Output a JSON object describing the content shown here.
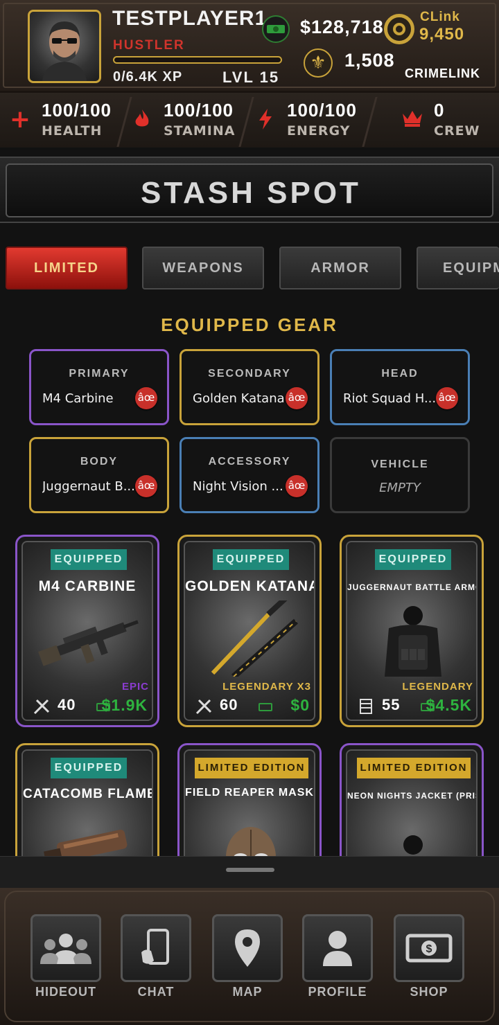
{
  "header": {
    "player_name": "TESTPLAYER1",
    "rank": "HUSTLER",
    "xp_text": "0/6.4K XP",
    "xp_progress": 0.0,
    "level_text": "LVL 15",
    "cash": "$128,718",
    "clink_label": "CLink",
    "clink_value": "9,450",
    "fleur_value": "1,508",
    "crimelink_label": "CRIMELINK"
  },
  "stats": [
    {
      "value": "100/100",
      "label": "HEALTH",
      "icon": "plus-icon",
      "color": "#e0302a"
    },
    {
      "value": "100/100",
      "label": "STAMINA",
      "icon": "flame-icon",
      "color": "#e0302a"
    },
    {
      "value": "100/100",
      "label": "ENERGY",
      "icon": "lightning-icon",
      "color": "#e0302a"
    },
    {
      "value": "0",
      "label": "CREW",
      "icon": "crown-icon",
      "color": "#e0302a"
    }
  ],
  "page_title": "STASH SPOT",
  "tabs": [
    {
      "label": "LIMITED",
      "active": true
    },
    {
      "label": "WEAPONS",
      "active": false
    },
    {
      "label": "ARMOR",
      "active": false
    },
    {
      "label": "EQUIPMENT",
      "active": false
    }
  ],
  "equipped_heading": "EQUIPPED GEAR",
  "slots": [
    {
      "label": "PRIMARY",
      "item": "M4 Carbine",
      "remove": "âœ",
      "rarity": "epic"
    },
    {
      "label": "SECONDARY",
      "item": "Golden Katana",
      "remove": "âœ",
      "rarity": "legendary"
    },
    {
      "label": "HEAD",
      "item": "Riot Squad H...",
      "remove": "âœ",
      "rarity": "rare"
    },
    {
      "label": "BODY",
      "item": "Juggernaut B...",
      "remove": "âœ",
      "rarity": "legendary"
    },
    {
      "label": "ACCESSORY",
      "item": "Night Vision ...",
      "remove": "âœ",
      "rarity": "rare"
    },
    {
      "label": "VEHICLE",
      "item": "EMPTY",
      "rarity": "empty"
    }
  ],
  "cards": [
    {
      "badge": "EQUIPPED",
      "name": "M4 CARBINE",
      "rarity": "EPIC",
      "stat": "40",
      "price": "$1.9K",
      "stat_icon": "attack-icon",
      "art": "rifle-icon"
    },
    {
      "badge": "EQUIPPED",
      "name": "GOLDEN KATANA",
      "rarity": "LEGENDARY X3",
      "stat": "60",
      "price": "$0",
      "stat_icon": "attack-icon",
      "art": "katana-icon"
    },
    {
      "badge": "EQUIPPED",
      "name": "JUGGERNAUT BATTLE ARMOR",
      "rarity": "LEGENDARY",
      "stat": "55",
      "price": "$4.5K",
      "stat_icon": "defense-icon",
      "art": "armor-icon"
    },
    {
      "badge": "EQUIPPED",
      "name": "CATACOMB FLAMER",
      "art": "flamer-icon"
    },
    {
      "badge": "LIMITED EDITION",
      "name": "FIELD REAPER MASK",
      "art": "mask-icon"
    },
    {
      "badge": "LIMITED EDITION",
      "name": "NEON NIGHTS JACKET (PRISM)",
      "art": "jacket-icon"
    }
  ],
  "nav": [
    {
      "label": "HIDEOUT",
      "icon": "group-icon"
    },
    {
      "label": "CHAT",
      "icon": "phone-icon"
    },
    {
      "label": "MAP",
      "icon": "map-pin-icon"
    },
    {
      "label": "PROFILE",
      "icon": "person-icon"
    },
    {
      "label": "SHOP",
      "icon": "cash-icon"
    }
  ]
}
